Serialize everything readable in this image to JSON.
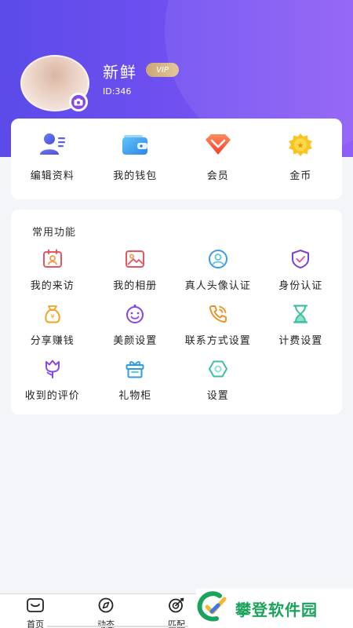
{
  "profile": {
    "name": "新鲜",
    "vip_badge": "VIP",
    "id_text": "ID:346"
  },
  "quick_actions": [
    {
      "label": "编辑资料",
      "icon": "user-edit-icon"
    },
    {
      "label": "我的钱包",
      "icon": "wallet-icon"
    },
    {
      "label": "会员",
      "icon": "diamond-icon"
    },
    {
      "label": "金币",
      "icon": "gold-coin-icon"
    }
  ],
  "functions": {
    "title": "常用功能",
    "items": [
      {
        "label": "我的来访",
        "icon": "visitors-icon"
      },
      {
        "label": "我的相册",
        "icon": "album-icon"
      },
      {
        "label": "真人头像认证",
        "icon": "avatar-verify-icon"
      },
      {
        "label": "身份认证",
        "icon": "shield-check-icon"
      },
      {
        "label": "分享赚钱",
        "icon": "money-bag-icon"
      },
      {
        "label": "美颜设置",
        "icon": "beauty-face-icon"
      },
      {
        "label": "联系方式设置",
        "icon": "phone-icon"
      },
      {
        "label": "计费设置",
        "icon": "hourglass-icon"
      },
      {
        "label": "收到的评价",
        "icon": "tulip-icon"
      },
      {
        "label": "礼物柜",
        "icon": "gift-box-icon"
      },
      {
        "label": "设置",
        "icon": "settings-icon"
      }
    ]
  },
  "tabs": [
    {
      "label": "首页",
      "icon": "home-icon"
    },
    {
      "label": "动态",
      "icon": "compass-icon"
    },
    {
      "label": "匹配",
      "icon": "target-icon"
    }
  ],
  "watermark": {
    "text": "攀登软件园"
  },
  "colors": {
    "header_start": "#5b4be8",
    "header_end": "#8f5cf6",
    "accent_purple": "#8a45e6"
  }
}
